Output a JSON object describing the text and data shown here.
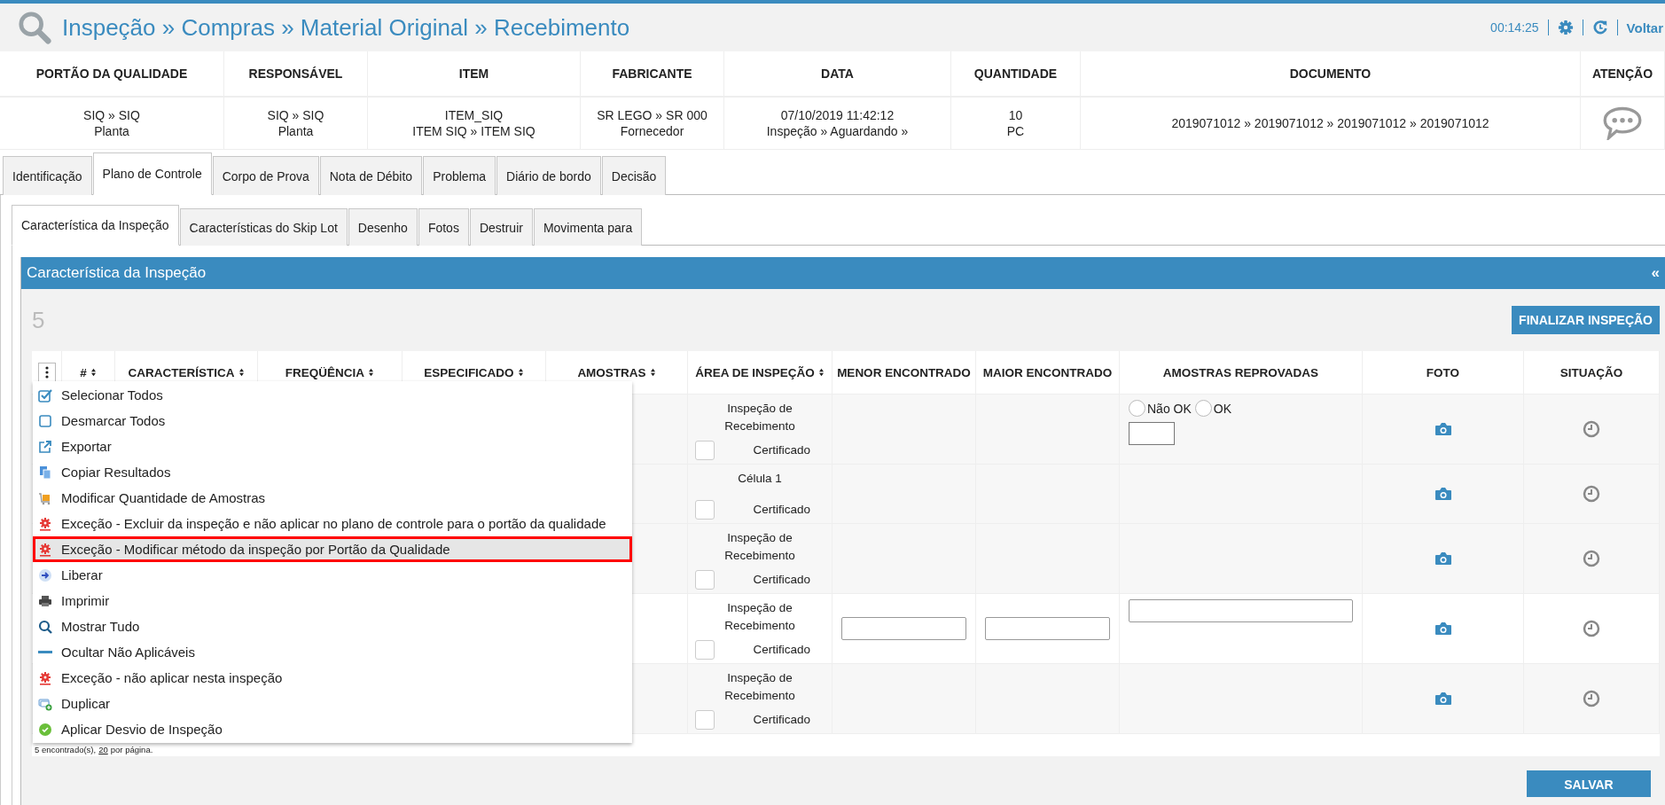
{
  "header": {
    "title": "Inspeção » Compras » Material Original » Recebimento",
    "timer": "00:14:25",
    "back_link": "Voltar"
  },
  "summary": {
    "columns": [
      "PORTÃO DA QUALIDADE",
      "RESPONSÁVEL",
      "ITEM",
      "FABRICANTE",
      "DATA",
      "QUANTIDADE",
      "DOCUMENTO",
      "ATENÇÃO"
    ],
    "values": [
      [
        "SIQ » SIQ",
        "Planta"
      ],
      [
        "SIQ » SIQ",
        "Planta"
      ],
      [
        "ITEM_SIQ",
        "ITEM SIQ » ITEM SIQ"
      ],
      [
        "SR LEGO » SR 000",
        "Fornecedor"
      ],
      [
        "07/10/2019 11:42:12",
        "Inspeção » Aguardando »"
      ],
      [
        "10",
        "PC"
      ],
      [
        "2019071012 » 2019071012 » 2019071012 » 2019071012"
      ]
    ]
  },
  "tabs": [
    {
      "label": "Identificação",
      "selected": false
    },
    {
      "label": "Plano de Controle",
      "selected": true
    },
    {
      "label": "Corpo de Prova",
      "selected": false
    },
    {
      "label": "Nota de Débito",
      "selected": false
    },
    {
      "label": "Problema",
      "selected": false
    },
    {
      "label": "Diário de bordo",
      "selected": false
    },
    {
      "label": "Decisão",
      "selected": false
    }
  ],
  "subtabs": [
    {
      "label": "Característica da Inspeção",
      "selected": true
    },
    {
      "label": "Características do Skip Lot",
      "selected": false
    },
    {
      "label": "Desenho",
      "selected": false
    },
    {
      "label": "Fotos",
      "selected": false
    },
    {
      "label": "Destruir",
      "selected": false
    },
    {
      "label": "Movimenta para",
      "selected": false
    }
  ],
  "panel": {
    "title": "Característica da Inspeção",
    "collapse": "«",
    "count": "5",
    "finish_button": "FINALIZAR INSPEÇÃO",
    "save_button": "SALVAR"
  },
  "table": {
    "columns": [
      {
        "label": "#",
        "sortable": true
      },
      {
        "label": "CARACTERÍSTICA",
        "sortable": true
      },
      {
        "label": "FREQÜÊNCIA",
        "sortable": true
      },
      {
        "label": "ESPECIFICADO",
        "sortable": true
      },
      {
        "label": "AMOSTRAS",
        "sortable": true
      },
      {
        "label": "ÁREA DE INSPEÇÃO",
        "sortable": true
      },
      {
        "label": "MENOR ENCONTRADO",
        "sortable": false
      },
      {
        "label": "MAIOR ENCONTRADO",
        "sortable": false
      },
      {
        "label": "AMOSTRAS REPROVADAS",
        "sortable": false
      },
      {
        "label": "FOTO",
        "sortable": false
      },
      {
        "label": "SITUAÇÃO",
        "sortable": false
      }
    ],
    "rows": [
      {
        "kind": "radio",
        "area": "Inspeção de Recebimento",
        "certificate": {
          "label": "Certificado",
          "checked": false
        },
        "options": [
          {
            "label": "Não OK",
            "selected": false
          },
          {
            "label": "OK",
            "selected": false
          }
        ]
      },
      {
        "kind": "plain",
        "area": "Célula 1",
        "certificate": {
          "label": "Certificado",
          "checked": false
        }
      },
      {
        "kind": "plain",
        "area": "Inspeção de Recebimento",
        "certificate": {
          "label": "Certificado",
          "checked": false
        }
      },
      {
        "kind": "inputs",
        "area": "Inspeção de Recebimento",
        "certificate": {
          "label": "Certificado",
          "checked": false
        }
      },
      {
        "kind": "plain",
        "area": "Inspeção de Recebimento",
        "certificate": {
          "label": "Certificado",
          "checked": false
        }
      }
    ],
    "footer": {
      "count": "5 encontrado(s),",
      "per_page": "20",
      "suffix": "por página."
    }
  },
  "menu": [
    {
      "kind": "check",
      "label": "Selecionar Todos",
      "selected": false
    },
    {
      "kind": "square",
      "label": "Desmarcar Todos",
      "selected": false
    },
    {
      "kind": "export",
      "label": "Exportar",
      "selected": false
    },
    {
      "kind": "copy",
      "label": "Copiar Resultados",
      "selected": false
    },
    {
      "kind": "cart",
      "label": "Modificar Quantidade de Amostras",
      "selected": false
    },
    {
      "kind": "exception",
      "label": "Exceção - Excluir da inspeção e não aplicar no plano de controle para o portão da qualidade",
      "selected": false
    },
    {
      "kind": "exception",
      "label": "Exceção - Modificar método da inspeção por Portão da Qualidade",
      "selected": true
    },
    {
      "kind": "arrow",
      "label": "Liberar",
      "selected": false
    },
    {
      "kind": "print",
      "label": "Imprimir",
      "selected": false
    },
    {
      "kind": "search",
      "label": "Mostrar Tudo",
      "selected": false
    },
    {
      "kind": "minus",
      "label": "Ocultar Não Aplicáveis",
      "selected": false
    },
    {
      "kind": "exception",
      "label": "Exceção - não aplicar nesta inspeção",
      "selected": false
    },
    {
      "kind": "duplicate",
      "label": "Duplicar",
      "selected": false
    },
    {
      "kind": "badge",
      "label": "Aplicar Desvio de Inspeção",
      "selected": false
    }
  ]
}
